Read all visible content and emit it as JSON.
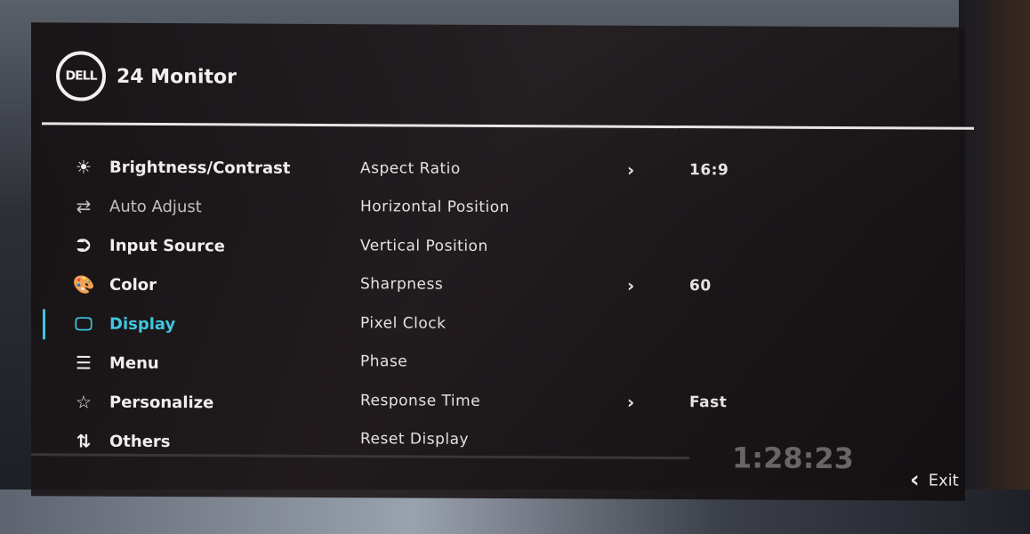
{
  "header": {
    "logo": "DELL",
    "title": "24 Monitor"
  },
  "nav": [
    {
      "label": "Brightness/Contrast",
      "icon": "sun-icon",
      "glyph": "☀"
    },
    {
      "label": "Auto Adjust",
      "icon": "swap-arrows-icon",
      "glyph": "⇄"
    },
    {
      "label": "Input Source",
      "icon": "input-icon",
      "glyph": "⮊"
    },
    {
      "label": "Color",
      "icon": "palette-icon",
      "glyph": "🎨"
    },
    {
      "label": "Display",
      "icon": "monitor-icon",
      "glyph": "🖵"
    },
    {
      "label": "Menu",
      "icon": "menu-list-icon",
      "glyph": "☰"
    },
    {
      "label": "Personalize",
      "icon": "star-icon",
      "glyph": "☆"
    },
    {
      "label": "Others",
      "icon": "others-icon",
      "glyph": "⇅"
    }
  ],
  "active_nav": "Display",
  "options": [
    {
      "label": "Aspect Ratio",
      "chevron": "›",
      "value": "16:9"
    },
    {
      "label": "Horizontal Position"
    },
    {
      "label": "Vertical Position"
    },
    {
      "label": "Sharpness",
      "chevron": "›",
      "value": "60"
    },
    {
      "label": "Pixel Clock"
    },
    {
      "label": "Phase"
    },
    {
      "label": "Response Time",
      "chevron": "›",
      "value": "Fast"
    },
    {
      "label": "Reset Display"
    }
  ],
  "timer": "1:28:23",
  "exit": {
    "label": "Exit",
    "glyph": "‹"
  },
  "colors": {
    "accent": "#3fc6e0"
  }
}
